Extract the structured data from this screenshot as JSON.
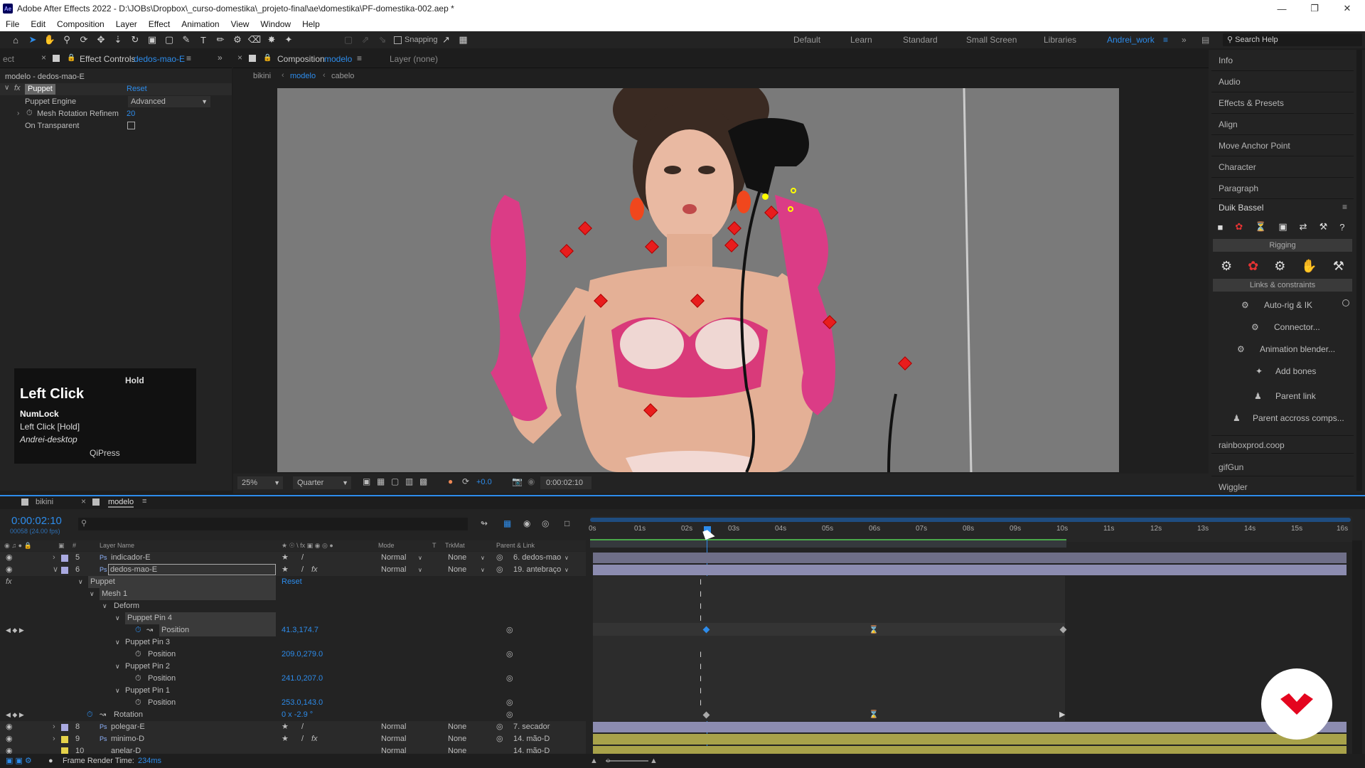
{
  "titlebar": {
    "title": "Adobe After Effects 2022 - D:\\JOBs\\Dropbox\\_curso-domestika\\_projeto-final\\ae\\domestika\\PF-domestika-002.aep *",
    "logo": "Ae"
  },
  "menubar": {
    "items": [
      "File",
      "Edit",
      "Composition",
      "Layer",
      "Effect",
      "Animation",
      "View",
      "Window",
      "Help"
    ]
  },
  "toolbar": {
    "snapping": "Snapping"
  },
  "workspaces": {
    "items": [
      "Default",
      "Learn",
      "Standard",
      "Small Screen",
      "Libraries",
      "Andrei_work"
    ],
    "search_placeholder": "Search Help"
  },
  "effect_panel": {
    "partial_tab": "ect",
    "tab_label": "Effect Controls",
    "tab_layer": "dedos-mao-E",
    "breadcrumb": "modelo - dedos-mao-E",
    "effect_name": "Puppet",
    "reset": "Reset",
    "engine_label": "Puppet Engine",
    "engine_value": "Advanced",
    "mesh_label": "Mesh Rotation Refinem",
    "mesh_value": "20",
    "transparent_label": "On Transparent"
  },
  "key_overlay": {
    "hold": "Hold",
    "title": "Left Click",
    "line1": "NumLock",
    "line2": "Left Click [Hold]",
    "line3": "Andrei-desktop",
    "footer": "QiPress"
  },
  "comp_panel": {
    "tab_label": "Composition",
    "tab_comp": "modelo",
    "layer_tab": "Layer (none)",
    "crumbs": [
      "bikini",
      "modelo",
      "cabelo"
    ],
    "zoom": "25%",
    "quality": "Quarter",
    "exposure": "+0.0",
    "timecode": "0:00:02:10"
  },
  "right_panel": {
    "items": [
      "Info",
      "Audio",
      "Effects & Presets",
      "Align",
      "Move Anchor Point",
      "Character",
      "Paragraph"
    ],
    "duik_title": "Duik Bassel",
    "rigging": "Rigging",
    "links": "Links & constraints",
    "duik_buttons": [
      "Auto-rig & IK",
      "Connector...",
      "Animation blender...",
      "Add bones",
      "Parent link",
      "Parent accross comps..."
    ],
    "extra": [
      "rainboxprod.coop",
      "gifGun",
      "Wiggler"
    ]
  },
  "timeline": {
    "tabs": [
      "bikini",
      "modelo"
    ],
    "timecode": "0:00:02:10",
    "frames": "00058 (24.00 fps)",
    "col_headers": {
      "name": "Layer Name",
      "mode": "Mode",
      "t": "T",
      "trkmat": "TrkMat",
      "parent": "Parent & Link"
    },
    "ruler": [
      "0s",
      "01s",
      "02s",
      "03s",
      "04s",
      "05s",
      "06s",
      "07s",
      "08s",
      "09s",
      "10s",
      "11s",
      "12s",
      "13s",
      "14s",
      "15s",
      "16s"
    ],
    "layers": [
      {
        "num": "5",
        "name": "indicador-E",
        "mode": "Normal",
        "trkmat": "None",
        "parent": "6. dedos-mao",
        "color": "#a9a9e0"
      },
      {
        "num": "6",
        "name": "dedos-mao-E",
        "mode": "Normal",
        "trkmat": "None",
        "parent": "19. antebraço",
        "color": "#a9a9e0"
      }
    ],
    "props": {
      "puppet": "Puppet",
      "reset": "Reset",
      "mesh": "Mesh 1",
      "deform": "Deform",
      "pins": [
        {
          "name": "Puppet Pin 4",
          "prop": "Position",
          "value": "41.3,174.7"
        },
        {
          "name": "Puppet Pin 3",
          "prop": "Position",
          "value": "209.0,279.0"
        },
        {
          "name": "Puppet Pin 2",
          "prop": "Position",
          "value": "241.0,207.0"
        },
        {
          "name": "Puppet Pin 1",
          "prop": "Position",
          "value": "253.0,143.0"
        }
      ],
      "rotation_label": "Rotation",
      "rotation_value": "0 x -2.9 °"
    },
    "bottom_layers": [
      {
        "num": "8",
        "name": "polegar-E",
        "mode": "Normal",
        "trkmat": "None",
        "parent": "7. secador",
        "color": "#a9a9e0"
      },
      {
        "num": "9",
        "name": "minimo-D",
        "mode": "Normal",
        "trkmat": "None",
        "parent": "14. mão-D",
        "color": "#e5d24a"
      },
      {
        "num": "10",
        "name": "anelar-D",
        "mode": "Normal",
        "trkmat": "None",
        "parent": "14. mão-D",
        "color": "#e5d24a"
      }
    ],
    "render_time_label": "Frame Render Time:",
    "render_time": "234ms"
  }
}
